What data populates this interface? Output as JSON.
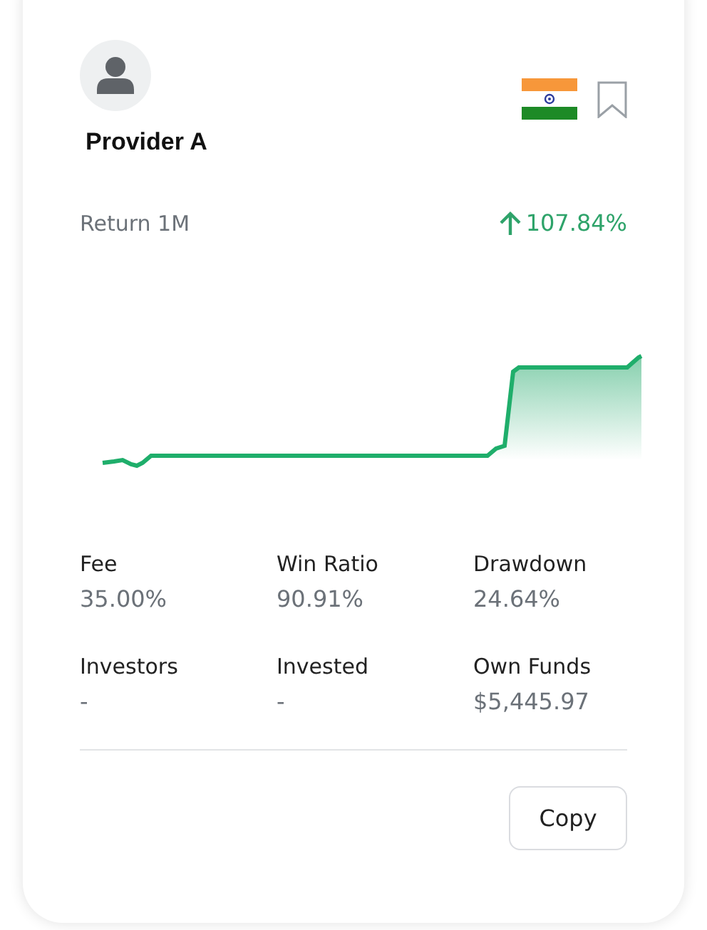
{
  "provider": {
    "name": "Provider A"
  },
  "return": {
    "label": "Return 1M",
    "value": "107.84%",
    "rising": true
  },
  "stats": [
    {
      "label": "Fee",
      "value": "35.00%"
    },
    {
      "label": "Win Ratio",
      "value": "90.91%"
    },
    {
      "label": "Drawdown",
      "value": "24.64%"
    },
    {
      "label": "Investors",
      "value": "-"
    },
    {
      "label": "Invested",
      "value": "-"
    },
    {
      "label": "Own Funds",
      "value": "$5,445.97"
    }
  ],
  "buttons": [
    "Copy"
  ]
}
